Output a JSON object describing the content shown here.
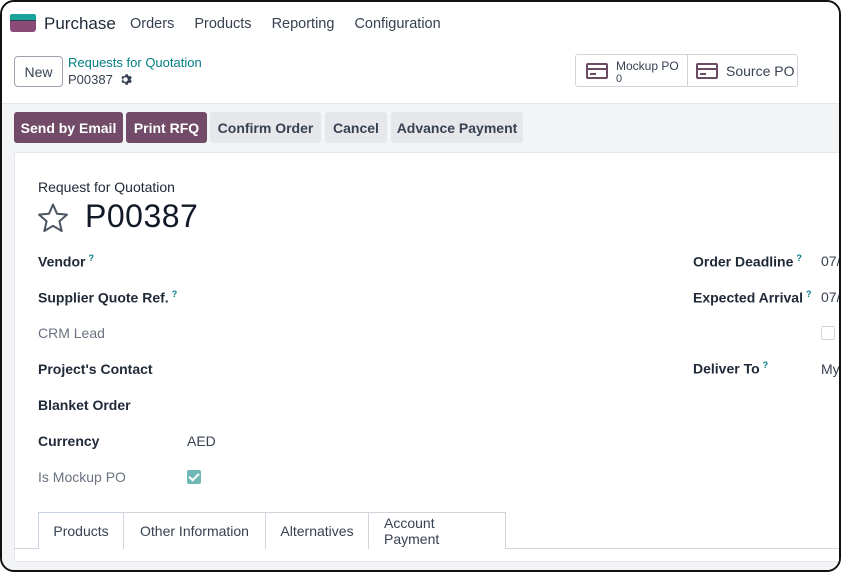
{
  "navbar": {
    "app_name": "Purchase",
    "menu": [
      "Orders",
      "Products",
      "Reporting",
      "Configuration"
    ]
  },
  "control": {
    "new_label": "New",
    "breadcrumb": "Requests for Quotation",
    "record_id": "P00387"
  },
  "smart_buttons": {
    "mockup_label": "Mockup PO",
    "mockup_value": "0",
    "source_label": "Source PO"
  },
  "actions": {
    "send_email": "Send by Email",
    "print_rfq": "Print RFQ",
    "confirm": "Confirm Order",
    "cancel": "Cancel",
    "advance": "Advance Payment"
  },
  "form": {
    "caption": "Request for Quotation",
    "number": "P00387",
    "help_mark": "?",
    "left_fields": {
      "vendor": "Vendor",
      "supplier_ref": "Supplier Quote Ref.",
      "crm_lead": "CRM Lead",
      "projects_contact": "Project's Contact",
      "blanket_order": "Blanket Order",
      "currency": "Currency",
      "currency_value": "AED",
      "is_mockup": "Is Mockup PO"
    },
    "right_fields": {
      "order_deadline": "Order Deadline",
      "order_deadline_value": "07/",
      "expected_arrival": "Expected Arrival",
      "expected_arrival_value": "07/",
      "deliver_to": "Deliver To",
      "deliver_to_value": "My"
    },
    "is_mockup_checked": true
  },
  "tabs": [
    "Products",
    "Other Information",
    "Alternatives",
    "Account Payment"
  ],
  "colors": {
    "primary": "#714b67",
    "link": "#017e84",
    "check": "#6fb8b6"
  }
}
